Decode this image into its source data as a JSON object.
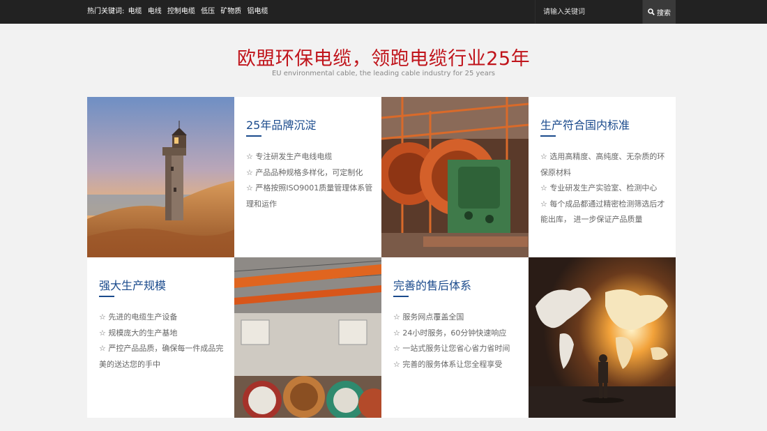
{
  "topbar": {
    "hot_label": "热门关键词:",
    "keywords": [
      "电缆",
      "电线",
      "控制电缆",
      "低压",
      "矿物质",
      "铝电缆"
    ],
    "search_placeholder": "请输入关键词",
    "search_button": "搜索"
  },
  "heading": {
    "title": "欧盟环保电缆，领跑电缆行业25年",
    "subtitle": "EU environmental cable, the leading cable industry for 25 years"
  },
  "features": [
    {
      "title": "25年品牌沉淀",
      "items": [
        "☆ 专注研发生产电线电缆",
        "☆ 产品品种规格多样化，可定制化",
        "☆ 严格按照ISO9001质量管理体系管理和运作"
      ]
    },
    {
      "title": "生产符合国内标准",
      "items": [
        "☆ 选用高精度、高纯度、无杂质的环保原材料",
        "☆ 专业研发生产实验室、检测中心",
        "☆ 每个成品都通过精密检测筛选后才能出库， 进一步保证产品质量"
      ]
    },
    {
      "title": "强大生产规模",
      "items": [
        "☆ 先进的电缆生产设备",
        "☆ 规模庞大的生产基地",
        "☆ 严控产品品质，确保每一件成品完美的送达您的手中"
      ]
    },
    {
      "title": "完善的售后体系",
      "items": [
        "☆ 服务网点覆盖全国",
        "☆ 24小时服务，60分钟快速响应",
        "☆ 一站式服务让您省心省力省时间",
        "☆ 完善的服务体系让您全程享受"
      ]
    }
  ],
  "colors": {
    "topbar": "#222222",
    "title_red": "#c0141b",
    "feature_blue": "#1a4a8c"
  }
}
